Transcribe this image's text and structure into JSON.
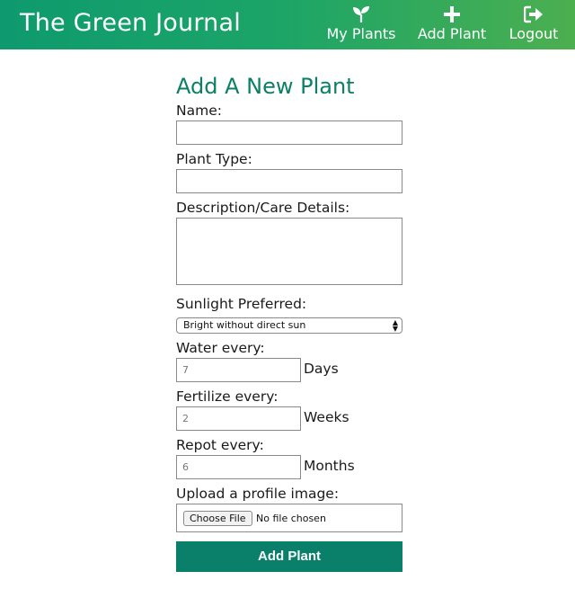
{
  "app": {
    "title": "The Green Journal"
  },
  "nav": {
    "my_plants": {
      "label": "My Plants",
      "icon": "sprout-icon"
    },
    "add_plant": {
      "label": "Add Plant",
      "icon": "plus-icon"
    },
    "logout": {
      "label": "Logout",
      "icon": "logout-icon"
    }
  },
  "form": {
    "title": "Add A New Plant",
    "name_label": "Name:",
    "name_value": "",
    "type_label": "Plant Type:",
    "type_value": "",
    "desc_label": "Description/Care Details:",
    "desc_value": "",
    "sunlight_label": "Sunlight Preferred:",
    "sunlight_selected": "Bright without direct sun",
    "water_label": "Water every:",
    "water_placeholder": "7",
    "water_unit": "Days",
    "fertilize_label": "Fertilize every:",
    "fertilize_placeholder": "2",
    "fertilize_unit": "Weeks",
    "repot_label": "Repot every:",
    "repot_placeholder": "6",
    "repot_unit": "Months",
    "image_label": "Upload a profile image:",
    "choose_file_label": "Choose File",
    "file_status": "No file chosen",
    "submit_label": "Add Plant"
  },
  "colors": {
    "header_gradient_start": "#0e9a6e",
    "header_gradient_end": "#4caf50",
    "accent": "#0a806a"
  }
}
